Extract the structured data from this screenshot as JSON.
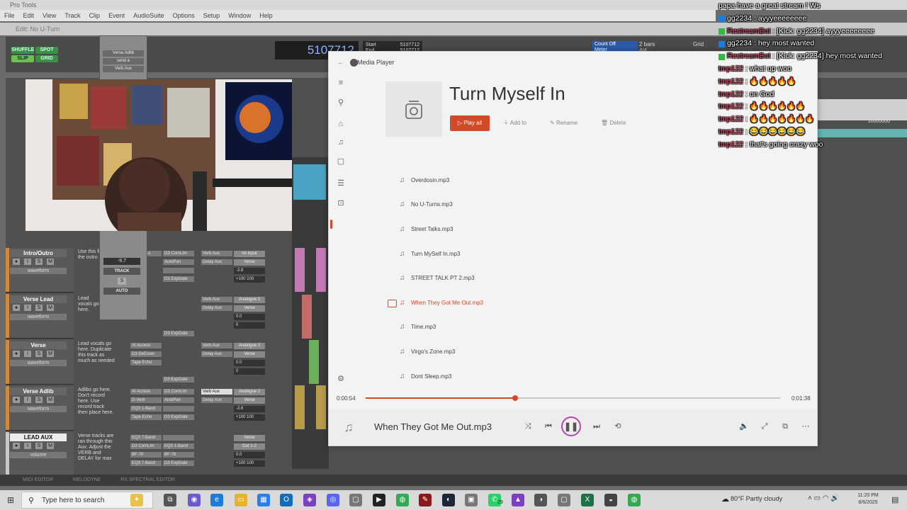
{
  "protools": {
    "title": "Pro Tools",
    "menu": [
      "File",
      "Edit",
      "View",
      "Track",
      "Clip",
      "Event",
      "AudioSuite",
      "Options",
      "Setup",
      "Window",
      "Help"
    ],
    "edit_window_title": "Edit: No U-Turn",
    "modes": {
      "shuffle": "SHUFFLE",
      "spot": "SPOT",
      "slip": "SLIP",
      "grid": "GRID"
    },
    "counter": "5107712",
    "start_label": "Start",
    "start_value": "5107712",
    "end_label": "End",
    "end_value": "5107712",
    "count_off": "Count Off",
    "meter": "Meter",
    "bars": "2 bars",
    "time_sig": "4/4",
    "grid_label": "Grid",
    "ruler_value": "20000000",
    "tracks": [
      {
        "name": "Intro/Outro",
        "view": "waveform",
        "dyn": "dyn",
        "read": "read",
        "note": "Use this filter for the outro if n",
        "inserts": [
          "AI Access",
          "",
          "",
          ""
        ],
        "inserts2": [
          "D3 ComLim",
          "AutoPan",
          "",
          "D3 ExpGate"
        ],
        "sends": [
          "Verb Aux",
          "Delay Aux"
        ],
        "io": [
          "no input",
          "Verse"
        ],
        "vol": "-3.8",
        "pan": "+100  100"
      },
      {
        "name": "Verse Lead",
        "view": "waveform",
        "dyn": "dyn",
        "read": "read",
        "note": "Lead vocals go here.",
        "inserts": [
          "",
          "",
          "",
          ""
        ],
        "inserts2": [
          "",
          "",
          "",
          "D3 ExpGate"
        ],
        "sends": [
          "Verb Aux",
          "Delay Aux"
        ],
        "io": [
          "Analogue 2",
          "Verse"
        ],
        "vol": "0.0",
        "pan": "0"
      },
      {
        "name": "Verse",
        "view": "waveform",
        "dyn": "dyn",
        "read": "read",
        "note": "Lead vocals go here. Duplicate this track as much as needed",
        "inserts": [
          "AI Access",
          "D3 DeEsser",
          "Tape Echo",
          ""
        ],
        "inserts2": [
          "",
          "",
          "",
          "D3 ExpGate"
        ],
        "sends": [
          "Verb Aux",
          "Delay Aux"
        ],
        "io": [
          "Analogue 2",
          "Verse"
        ],
        "vol": "0.0",
        "pan": "0"
      },
      {
        "name": "Verse Adlib",
        "view": "waveform",
        "dyn": "dyn",
        "read": "read",
        "note": "Adlibs go here. Don't record here. Use record track then place here.",
        "inserts": [
          "AI Access",
          "D-Verb",
          "EQ3 1-Band",
          "Tape Echo"
        ],
        "inserts2": [
          "D3 ComLim",
          "AutoPan",
          "",
          "D3 ExpGate"
        ],
        "sends": [
          "Verb Aux",
          "Delay Aux"
        ],
        "io": [
          "Analogue 2",
          "Verse"
        ],
        "vol": "-3.6",
        "pan": "+100  100"
      },
      {
        "name": "LEAD AUX",
        "view": "volume",
        "dyn": "dyn",
        "read": "read",
        "note": "Verse tracks are ran through this Aux. Adjust the VERB and DELAY for max",
        "inserts": [
          "EQ3 7-Band",
          "D3 ComLim",
          "BF-76",
          "EQ3 7-Band"
        ],
        "inserts2": [
          "",
          "EQ3 1-Band",
          "BF-76",
          "D3 ExpGate"
        ],
        "sends": [
          "",
          ""
        ],
        "io": [
          "Verse",
          "Out 1-2"
        ],
        "vol": "0.0",
        "pan": "+100  100"
      }
    ],
    "mini": {
      "name": "Verse Adlib",
      "send": "send a",
      "aux": "Verb Aux",
      "pan": "-9.7",
      "track": "TRACK",
      "auto": "AUTO",
      "solo": "S"
    },
    "bottom_tabs": [
      "MIDI EDITOR",
      "MELODYNE",
      "RX SPECTRAL EDITOR"
    ]
  },
  "media_player": {
    "app_title": "Media Player",
    "heading": "Turn Myself In",
    "play_all": "Play all",
    "add_to": "Add to",
    "rename": "Rename",
    "delete": "Delete",
    "songs": [
      "Overdosin.mp3",
      "No U-Turns.mp3",
      "Street Talks.mp3",
      "Turn MySelf In.mp3",
      "STREET TALK PT 2.mp3",
      "When They Got Me Out.mp3",
      "Time.mp3",
      "Virgo's Zone.mp3",
      "Dont Sleep.mp3"
    ],
    "playing_index": 5,
    "time_current": "0:00:54",
    "time_total": "0:01:38",
    "progress": 0.36,
    "now_playing": "When They Got Me Out.mp3",
    "accent": "#d24b28"
  },
  "chat": [
    {
      "user": "",
      "text": "papa have a great stream ! Ws",
      "badge": "",
      "color": "#ffffff"
    },
    {
      "user": "gg2234",
      "text": ": ayyyeeeeeeee",
      "badge": "blue",
      "color": "#ffffff"
    },
    {
      "user": "RestreamBot",
      "text": ": [Kick: gg2234] ayyyeeeeeeee",
      "badge": "green",
      "color": "#e0506a"
    },
    {
      "user": "gg2234",
      "text": ": hey most wanted",
      "badge": "blue",
      "color": "#ffffff"
    },
    {
      "user": "RestreamBot",
      "text": ": [Kick: gg2234] hey most wanted",
      "badge": "green",
      "color": "#e0506a"
    },
    {
      "user": "tmp122",
      "text": ": what up woo",
      "badge": "",
      "color": "#e0506a"
    },
    {
      "user": "tmp122",
      "text": ": 🔥🔥🔥🔥🔥",
      "badge": "",
      "color": "#e0506a"
    },
    {
      "user": "tmp122",
      "text": ": on God",
      "badge": "",
      "color": "#e0506a"
    },
    {
      "user": "tmp122",
      "text": ": 🔥🔥🔥🔥🔥🔥",
      "badge": "",
      "color": "#e0506a"
    },
    {
      "user": "tmp122",
      "text": ": 🔥🔥🔥🔥🔥🔥🔥",
      "badge": "",
      "color": "#e0506a"
    },
    {
      "user": "tmp122",
      "text": ": 😂😂😂😂😂😂",
      "badge": "",
      "color": "#e0506a"
    },
    {
      "user": "tmp122",
      "text": ": that's going crazy woo",
      "badge": "",
      "color": "#e0506a"
    }
  ],
  "taskbar": {
    "search_placeholder": "Type here to search",
    "weather": "80°F  Partly cloudy",
    "time": "11:20 PM",
    "date": "8/6/2025",
    "whatsapp_badge": "29"
  }
}
